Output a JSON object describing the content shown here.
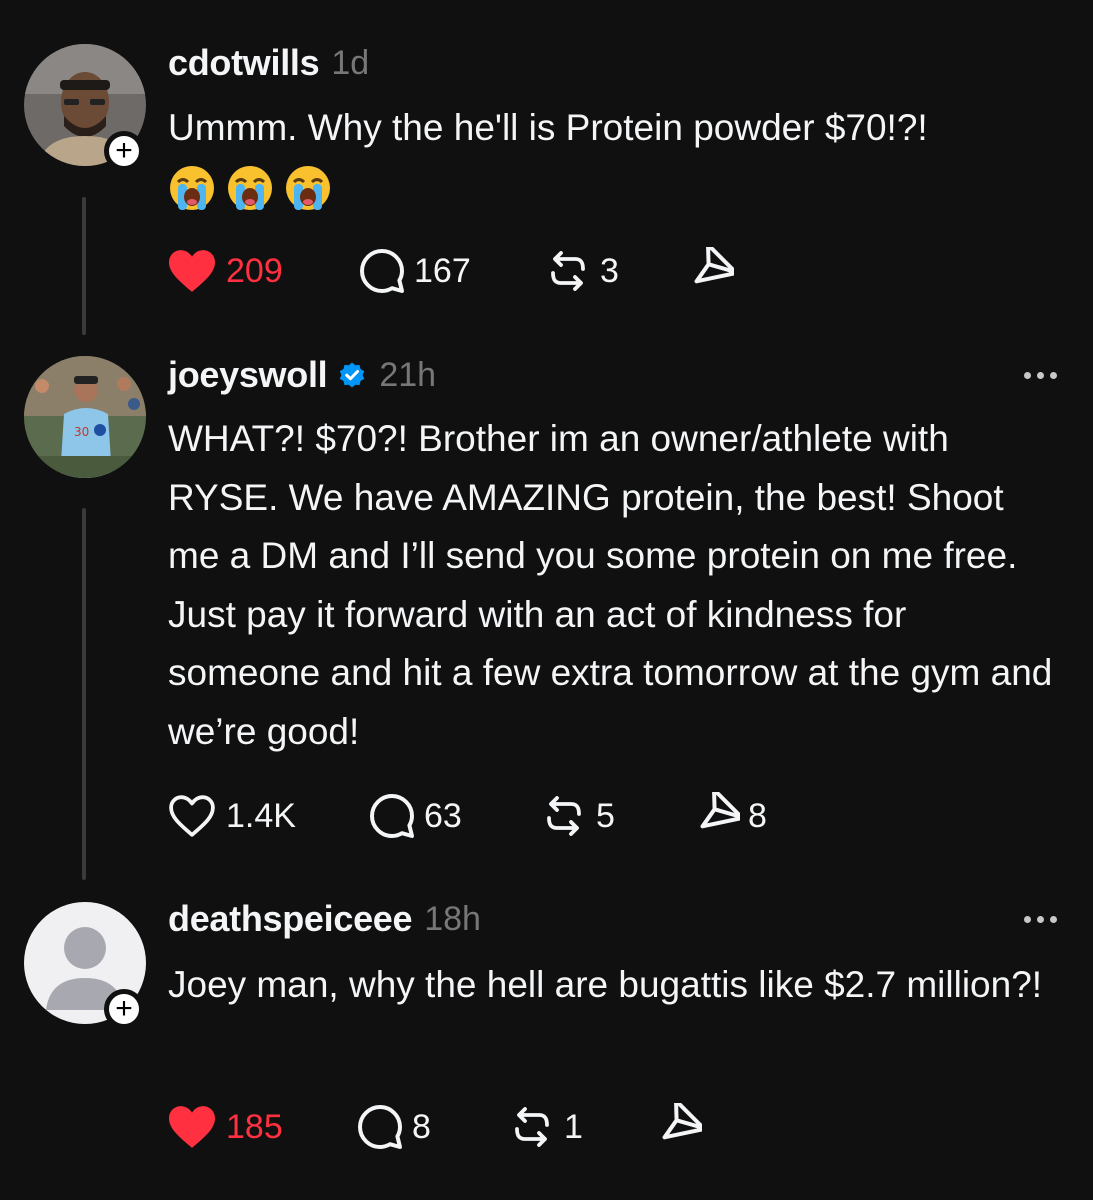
{
  "posts": [
    {
      "username": "cdotwills",
      "timestamp": "1d",
      "text": "Ummm. Why the he'll is Protein powder $70!?!",
      "emojis": [
        "loudly-crying-face",
        "loudly-crying-face",
        "loudly-crying-face"
      ],
      "liked": true,
      "likes": "209",
      "replies": "167",
      "reposts": "3",
      "shares": ""
    },
    {
      "username": "joeyswoll",
      "verified": true,
      "timestamp": "21h",
      "text": "WHAT?! $70?! Brother im an owner/athlete with RYSE. We have AMAZING protein, the best! Shoot me a DM and I’ll send you some protein on me free. Just pay it forward with an act of kindness for someone and hit a few extra tomorrow at the gym and we’re good!",
      "liked": false,
      "likes": "1.4K",
      "replies": "63",
      "reposts": "5",
      "shares": "8"
    },
    {
      "username": "deathspeiceee",
      "timestamp": "18h",
      "text": "Joey man, why the hell are bugattis like $2.7 million?!",
      "liked": true,
      "likes": "185",
      "replies": "8",
      "reposts": "1",
      "shares": ""
    }
  ],
  "colors": {
    "background": "#101010",
    "text": "#f3f5f7",
    "muted": "#777777",
    "like_red": "#ff3040",
    "verified_blue": "#0095f6"
  }
}
